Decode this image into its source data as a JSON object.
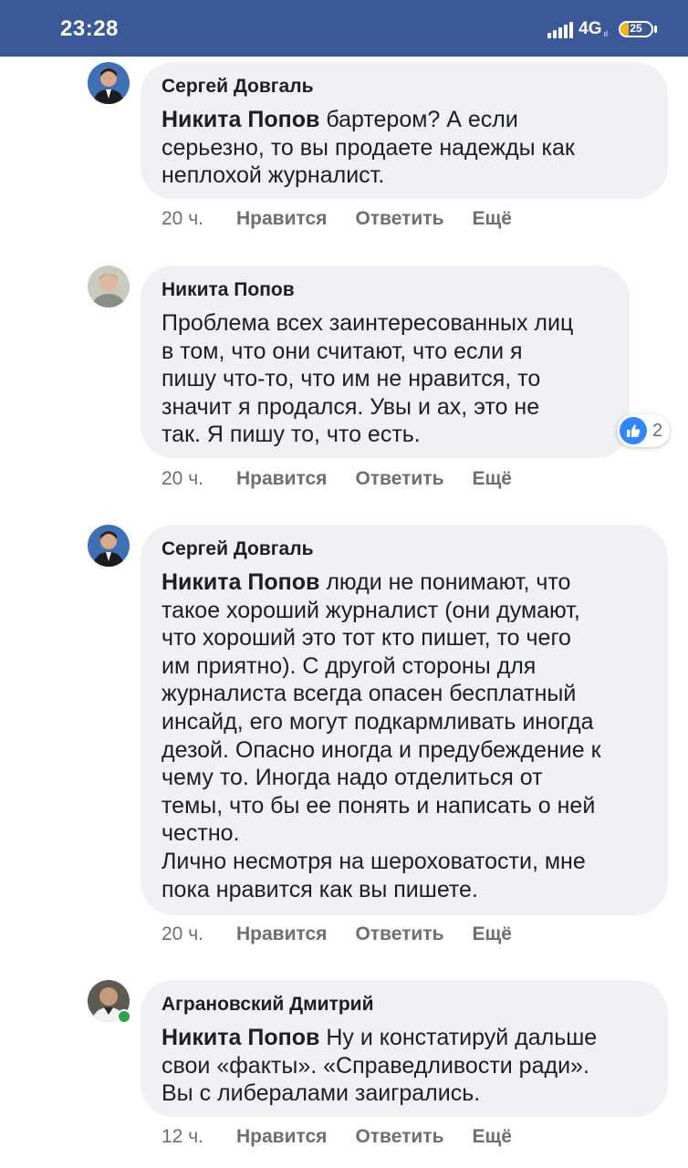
{
  "status_bar": {
    "time": "23:28",
    "network": "4G",
    "network_sub": "ıl",
    "battery": "25",
    "battery_level": 0.25,
    "background_color": "#3b5998"
  },
  "comments": [
    {
      "author": "Сергей Довгаль",
      "mention": "Никита Попов",
      "text": " бартером? А если\nсерьезно, то вы продаете надежды как\nнеплохой журналист.",
      "time": "20 ч.",
      "actions": [
        "Нравится",
        "Ответить",
        "Ещё"
      ]
    },
    {
      "author": "Никита Попов",
      "mention": "",
      "text": "Проблема всех заинтересованных лиц\nв том, что они считают, что если я\nпишу что-то, что им не нравится, то\nзначит я продался. Увы и ах, это не\nтак. Я пишу то, что есть.",
      "time": "20 ч.",
      "actions": [
        "Нравится",
        "Ответить",
        "Ещё"
      ],
      "reaction": {
        "icon": "like-icon",
        "count": "2"
      }
    },
    {
      "author": "Сергей Довгаль",
      "mention": "Никита Попов",
      "text": " люди не понимают, что\nтакое хороший журналист (они думают,\nчто хороший это тот кто пишет, то чего\nим приятно). С другой стороны для\nжурналиста всегда опасен бесплатный\nинсайд, его могут подкармливать иногда\nдезой. Опасно иногда и предубеждение к\nчему то. Иногда надо отделиться от\nтемы, что бы ее понять и написать о ней\nчестно.\nЛично несмотря на шероховатости, мне\nпока нравится как вы пишете.",
      "time": "20 ч.",
      "actions": [
        "Нравится",
        "Ответить",
        "Ещё"
      ]
    },
    {
      "author": "Аграновский Дмитрий",
      "mention": "Никита Попов",
      "text": " Ну и констатируй дальше\nсвои «факты». «Справедливости ради».\nВы с либералами заигрались.",
      "time": "12 ч.",
      "actions": [
        "Нравится",
        "Ответить",
        "Ещё"
      ],
      "online": true
    }
  ]
}
